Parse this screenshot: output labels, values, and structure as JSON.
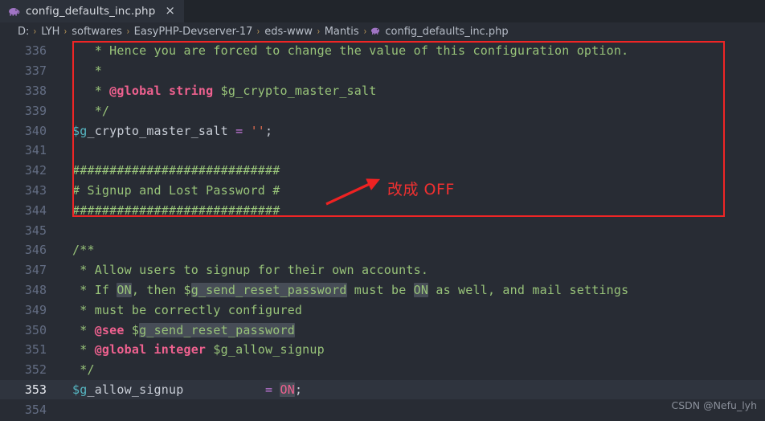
{
  "tab": {
    "icon": "php-elephant-icon",
    "filename": "config_defaults_inc.php",
    "close_label": "×"
  },
  "breadcrumb": {
    "segments": [
      "D:",
      "LYH",
      "softwares",
      "EasyPHP-Devserver-17",
      "eds-www",
      "Mantis"
    ],
    "separator": "›",
    "file": "config_defaults_inc.php"
  },
  "editor": {
    "active_line": 353,
    "lines": [
      {
        "num": "336",
        "segments": [
          {
            "text": "   * Hence you are forced to change the value of this configuration option.",
            "cls": "c-comment"
          }
        ]
      },
      {
        "num": "337",
        "segments": [
          {
            "text": "   *",
            "cls": "c-comment"
          }
        ]
      },
      {
        "num": "338",
        "segments": [
          {
            "text": "   * ",
            "cls": "c-comment"
          },
          {
            "text": "@global string",
            "cls": "c-doctag"
          },
          {
            "text": " $g_crypto_master_salt",
            "cls": "c-comment"
          }
        ]
      },
      {
        "num": "339",
        "segments": [
          {
            "text": "   */",
            "cls": "c-comment"
          }
        ]
      },
      {
        "num": "340",
        "segments": [
          {
            "text": "$g",
            "cls": "c-dollar"
          },
          {
            "text": "_crypto_master_salt ",
            "cls": "c-var"
          },
          {
            "text": "=",
            "cls": "c-op"
          },
          {
            "text": " ",
            "cls": "c-var"
          },
          {
            "text": "''",
            "cls": "c-str"
          },
          {
            "text": ";",
            "cls": "c-var"
          }
        ]
      },
      {
        "num": "341",
        "segments": [
          {
            "text": "",
            "cls": "c-comment"
          }
        ]
      },
      {
        "num": "342",
        "segments": [
          {
            "text": "############################",
            "cls": "c-comment"
          }
        ]
      },
      {
        "num": "343",
        "segments": [
          {
            "text": "# Signup and Lost Password #",
            "cls": "c-comment"
          }
        ]
      },
      {
        "num": "344",
        "segments": [
          {
            "text": "############################",
            "cls": "c-comment"
          }
        ]
      },
      {
        "num": "345",
        "segments": [
          {
            "text": "",
            "cls": "c-comment"
          }
        ]
      },
      {
        "num": "346",
        "segments": [
          {
            "text": "/**",
            "cls": "c-comment"
          }
        ]
      },
      {
        "num": "347",
        "segments": [
          {
            "text": " * Allow users to signup for their own accounts.",
            "cls": "c-comment"
          }
        ]
      },
      {
        "num": "348",
        "segments": [
          {
            "text": " * If ",
            "cls": "c-comment"
          },
          {
            "text": "ON",
            "cls": "c-comment hl"
          },
          {
            "text": ", then $",
            "cls": "c-comment"
          },
          {
            "text": "g_send_reset_password",
            "cls": "c-comment hl"
          },
          {
            "text": " must be ",
            "cls": "c-comment"
          },
          {
            "text": "ON",
            "cls": "c-comment hl"
          },
          {
            "text": " as well, and mail settings",
            "cls": "c-comment"
          }
        ]
      },
      {
        "num": "349",
        "segments": [
          {
            "text": " * must be correctly configured",
            "cls": "c-comment"
          }
        ]
      },
      {
        "num": "350",
        "segments": [
          {
            "text": " * ",
            "cls": "c-comment"
          },
          {
            "text": "@see",
            "cls": "c-doctag"
          },
          {
            "text": " $",
            "cls": "c-comment"
          },
          {
            "text": "g_send_reset_password",
            "cls": "c-comment hl"
          }
        ]
      },
      {
        "num": "351",
        "segments": [
          {
            "text": " * ",
            "cls": "c-comment"
          },
          {
            "text": "@global integer",
            "cls": "c-doctag"
          },
          {
            "text": " $g_allow_signup",
            "cls": "c-comment"
          }
        ]
      },
      {
        "num": "352",
        "segments": [
          {
            "text": " */",
            "cls": "c-comment"
          }
        ]
      },
      {
        "num": "353",
        "segments": [
          {
            "text": "$g",
            "cls": "c-dollar"
          },
          {
            "text": "_allow_signup           ",
            "cls": "c-var"
          },
          {
            "text": "=",
            "cls": "c-op"
          },
          {
            "text": " ",
            "cls": "c-var"
          },
          {
            "text": "ON",
            "cls": "c-const hl"
          },
          {
            "text": ";",
            "cls": "c-var"
          }
        ]
      },
      {
        "num": "354",
        "segments": [
          {
            "text": "",
            "cls": "c-comment"
          }
        ]
      }
    ]
  },
  "annotation": {
    "text": "改成 OFF",
    "color": "#f03030",
    "arrow": "red-arrow-icon",
    "highlight_box": "red-rectangle"
  },
  "watermark": {
    "text": "CSDN @Nefu_lyh"
  }
}
